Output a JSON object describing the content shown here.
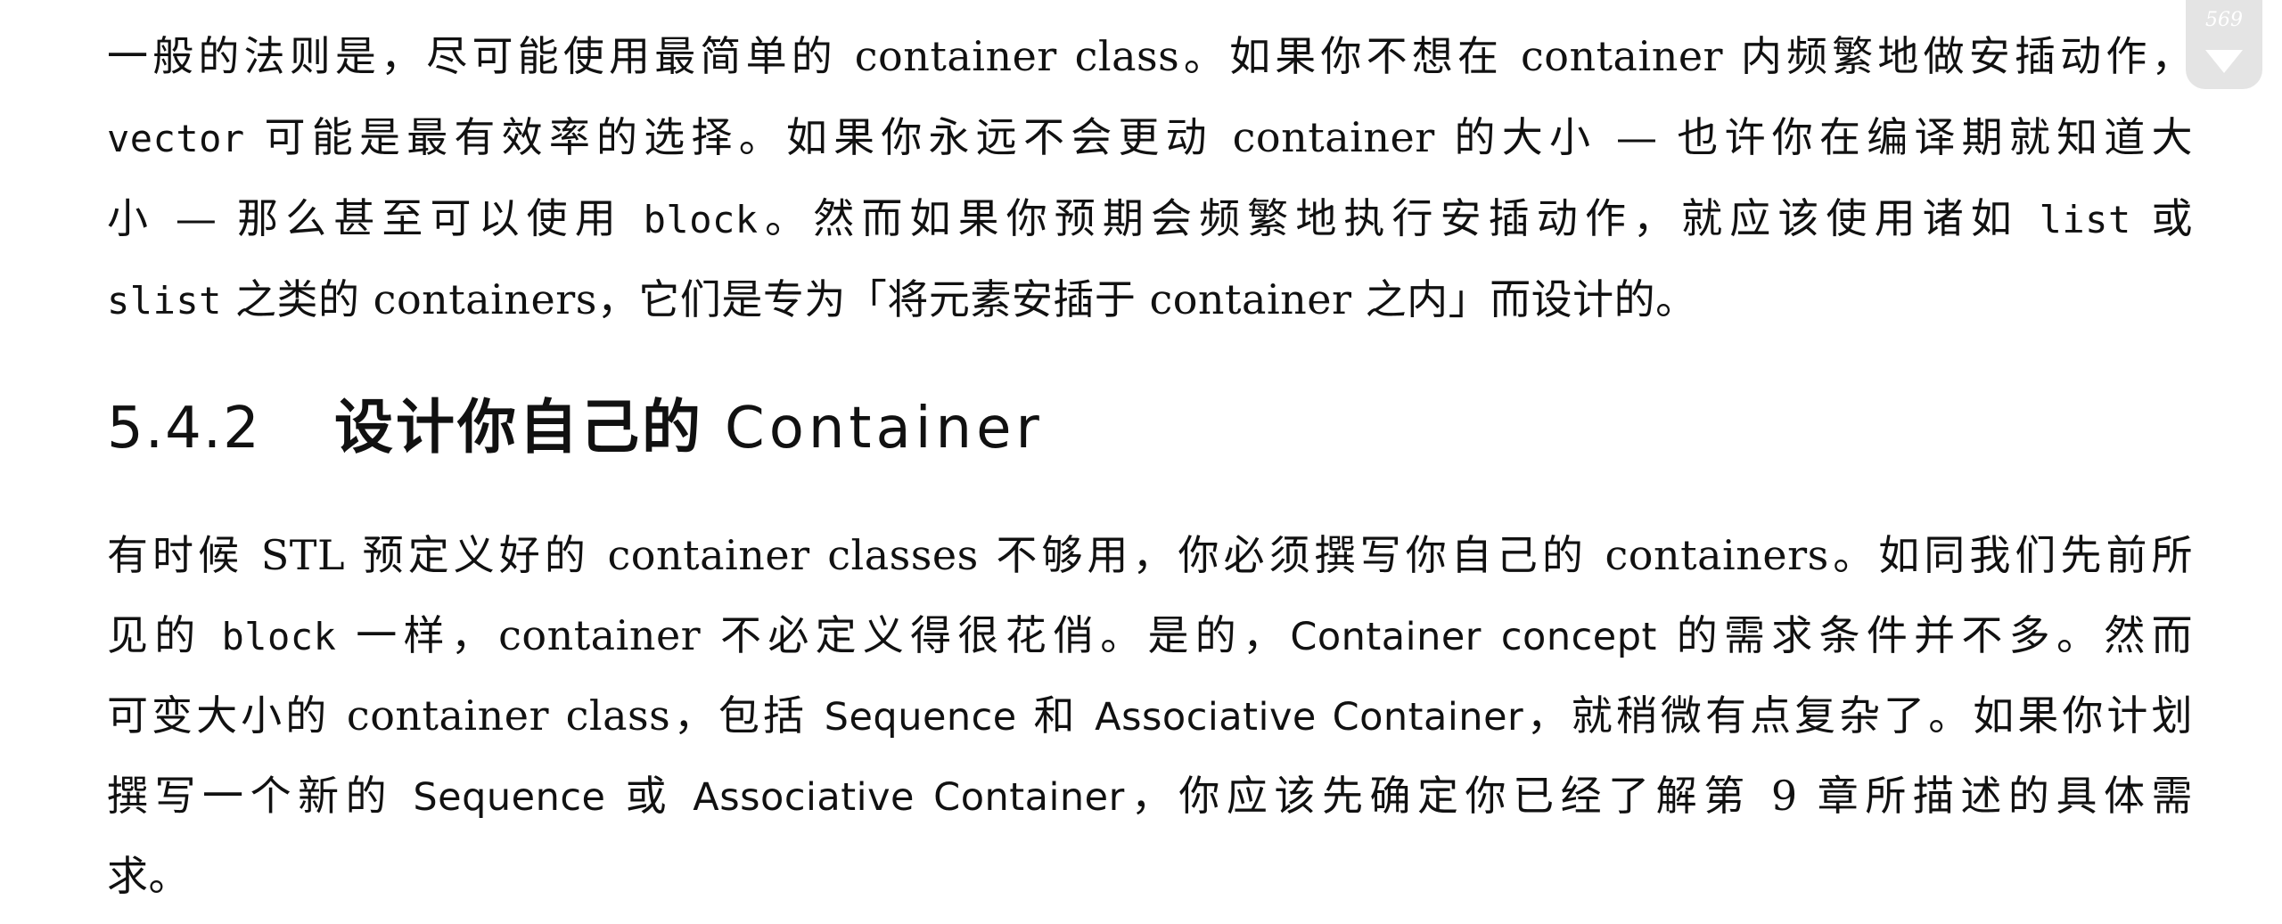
{
  "page_number": "569",
  "paragraph1": {
    "lines": [
      [
        {
          "t": "一般的法则是，尽可能使用最简单的 container class。如果你不想在 container 内频繁地做安插动作，"
        }
      ],
      [
        {
          "t": "vector",
          "s": "mono"
        },
        {
          "t": " 可能是最有效率的选择。如果你永远不会更动 container 的大小 — 也许你在编译期就知道大"
        }
      ],
      [
        {
          "t": "小 — 那么甚至可以使用 "
        },
        {
          "t": "block",
          "s": "mono"
        },
        {
          "t": "。然而如果你预期会频繁地执行安插动作，就应该使用诸如 "
        },
        {
          "t": "list",
          "s": "mono"
        },
        {
          "t": " 或"
        }
      ],
      [
        {
          "t": "slist",
          "s": "mono"
        },
        {
          "t": " 之类的 containers，它们是专为「将元素安插于 container 之内」而设计的。"
        }
      ]
    ]
  },
  "heading": {
    "number": "5.4.2",
    "title_zh": "设计你自己的",
    "title_en": "Container"
  },
  "paragraph2": {
    "lines": [
      [
        {
          "t": "有时候 STL 预定义好的 container classes 不够用，你必须撰写你自己的 containers。如同我们先前所"
        }
      ],
      [
        {
          "t": "见的 "
        },
        {
          "t": "block",
          "s": "mono"
        },
        {
          "t": " 一样，container 不必定义得很花俏。是的，"
        },
        {
          "t": "Container",
          "s": "sans"
        },
        {
          "t": " "
        },
        {
          "t": "concept",
          "s": "sans"
        },
        {
          "t": " 的需求条件并不多。然而"
        }
      ],
      [
        {
          "t": "可变大小的 container class，包括 "
        },
        {
          "t": "Sequence",
          "s": "sans"
        },
        {
          "t": " 和 "
        },
        {
          "t": "Associative Container",
          "s": "sans"
        },
        {
          "t": "，就稍微有点复杂了。如果你计划"
        }
      ],
      [
        {
          "t": "撰写一个新的 "
        },
        {
          "t": "Sequence",
          "s": "sans"
        },
        {
          "t": " 或 "
        },
        {
          "t": "Associative Container",
          "s": "sans"
        },
        {
          "t": "，你应该先确定你已经了解第 9 章所描述的具体需"
        }
      ],
      [
        {
          "t": "求。"
        }
      ]
    ]
  }
}
